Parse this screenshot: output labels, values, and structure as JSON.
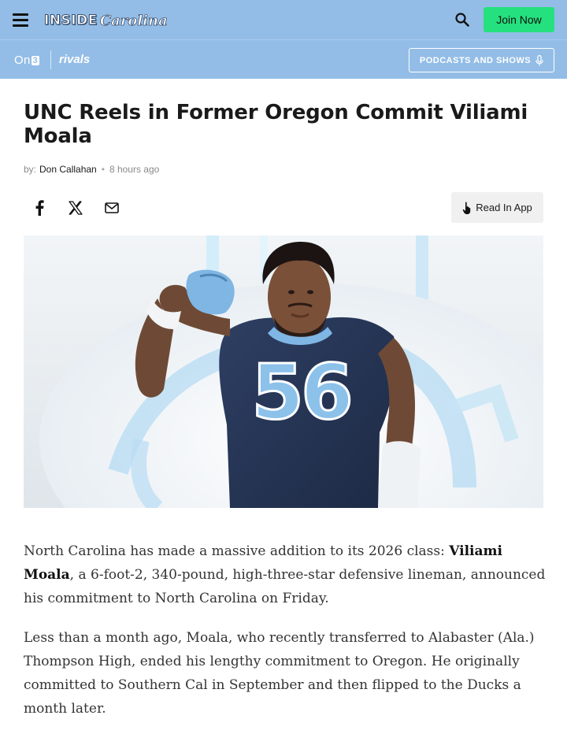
{
  "header": {
    "logo_main": "INSIDE",
    "logo_script": "Carolina",
    "join_label": "Join Now",
    "brand_on3": "On",
    "brand_on3_num": "3",
    "brand_rivals": "rivals",
    "podcasts_label": "PODCASTS AND SHOWS",
    "colors": {
      "bar": "#93bde6",
      "join": "#25e07e"
    }
  },
  "article": {
    "title": "UNC Reels in Former Oregon Commit Viliami Moala",
    "byline_prefix": "by:",
    "author": "Don Callahan",
    "separator": "•",
    "time_ago": "8 hours ago",
    "share": {
      "icons": [
        "facebook-icon",
        "x-icon",
        "mail-icon"
      ]
    },
    "read_in_app": "Read In App",
    "hero_jersey_number": "56",
    "paragraphs": [
      {
        "before": "North Carolina has made a massive addition to its 2026 class: ",
        "link": "Viliami Moala",
        "after": ", a 6-foot-2, 340-pound, high-three-star defensive lineman, announced his commitment to North Carolina on Friday."
      },
      {
        "text": "Less than a month ago, Moala, who recently transferred to Alabaster (Ala.) Thompson High, ended his lengthy commitment to Oregon. He originally committed to Southern Cal in September and then flipped to the Ducks a month later."
      }
    ]
  }
}
